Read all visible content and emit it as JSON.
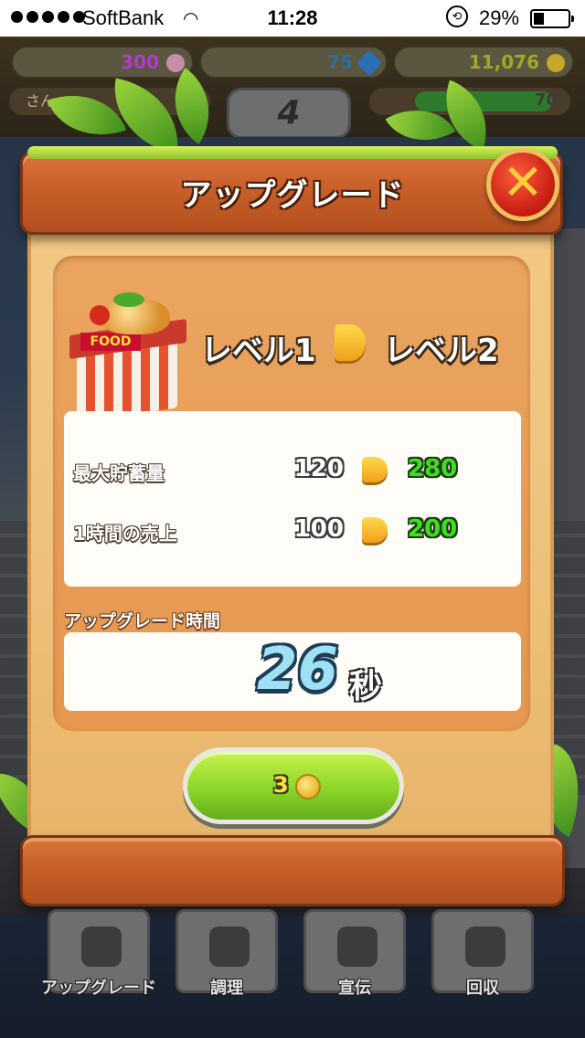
{
  "status_bar": {
    "carrier": "SoftBank",
    "time": "11:28",
    "battery_percent": "29%",
    "battery_level": 0.29
  },
  "hud": {
    "gems": "300",
    "crystals": "75",
    "coins": "11,076",
    "player_name": "さん",
    "player_level": "4",
    "xp_value": "70"
  },
  "dialog": {
    "title": "アップグレード",
    "close_symbol": "✕",
    "shop_sign": "FOOD",
    "level_from": "レベル1",
    "level_to": "レベル2",
    "stats": [
      {
        "label": "最大貯蓄量",
        "old": "120",
        "new": "280"
      },
      {
        "label": "1時間の売上",
        "old": "100",
        "new": "200"
      }
    ],
    "time_label": "アップグレード時間",
    "time_value": "26",
    "time_unit": "秒",
    "buy_cost": "3",
    "buy_icon": "coin-icon"
  },
  "tabs": [
    {
      "label": "アップグレード",
      "icon": "upgrade-icon"
    },
    {
      "label": "調理",
      "icon": "pot-icon"
    },
    {
      "label": "宣伝",
      "icon": "megaphone-icon"
    },
    {
      "label": "回収",
      "icon": "coins-icon"
    }
  ],
  "colors": {
    "board": "#c75e28",
    "parchment": "#efc27c",
    "panel": "#e6974f",
    "new_value": "#3ce01e",
    "button": "#8cd52a",
    "close": "#c41c12"
  }
}
